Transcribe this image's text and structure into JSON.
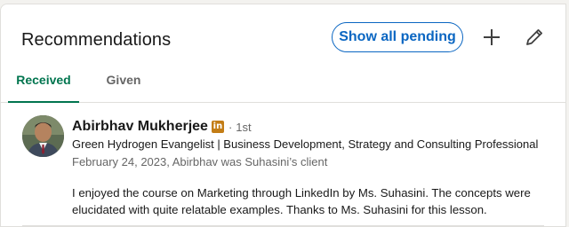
{
  "section": {
    "title": "Recommendations",
    "show_pending_label": "Show all pending",
    "add_icon": "plus-icon",
    "edit_icon": "pencil-icon"
  },
  "tabs": [
    {
      "label": "Received",
      "active": true
    },
    {
      "label": "Given",
      "active": false
    }
  ],
  "recommendation": {
    "name": "Abirbhav Mukherjee",
    "badge_icon": "linkedin-icon",
    "separator": "·",
    "degree": "1st",
    "headline": "Green Hydrogen Evangelist | Business Development, Strategy and Consulting Professional",
    "meta": "February 24, 2023, Abirbhav was Suhasini’s client",
    "text": "I enjoyed the course on Marketing through LinkedIn by Ms. Suhasini. The concepts were elucidated with quite relatable examples. Thanks to Ms. Suhasini for this lesson."
  },
  "colors": {
    "brand_blue": "#0a66c2",
    "active_tab_green": "#01754f",
    "badge_gold": "#c37d16"
  }
}
